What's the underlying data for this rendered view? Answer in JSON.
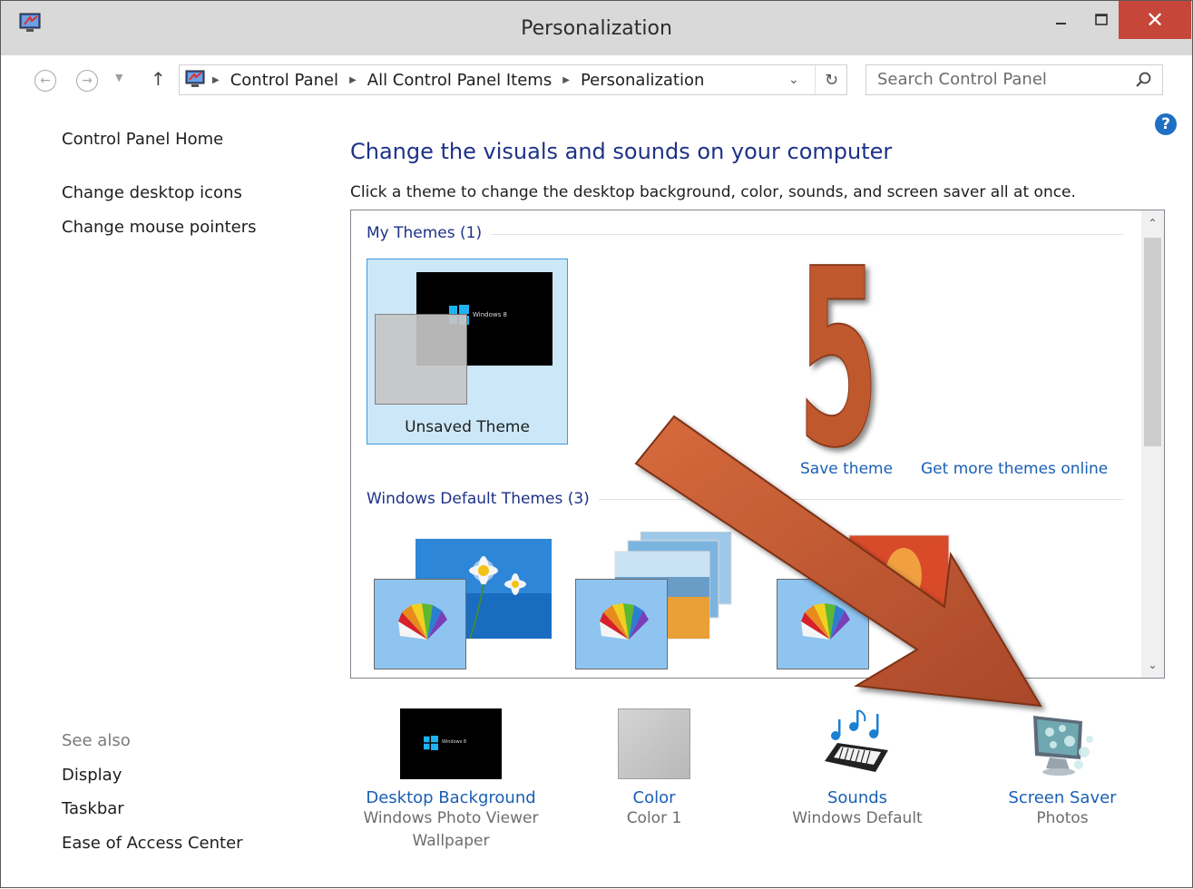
{
  "window": {
    "title": "Personalization",
    "close_glyph": "✕"
  },
  "address": {
    "crumbs": [
      "Control Panel",
      "All Control Panel Items",
      "Personalization"
    ]
  },
  "search": {
    "placeholder": "Search Control Panel"
  },
  "left_nav": {
    "items": [
      "Control Panel Home",
      "Change desktop icons",
      "Change mouse pointers"
    ]
  },
  "see_also": {
    "label": "See also",
    "items": [
      "Display",
      "Taskbar",
      "Ease of Access Center"
    ]
  },
  "main": {
    "heading": "Change the visuals and sounds on your computer",
    "subtext": "Click a theme to change the desktop background, color, sounds, and screen saver all at once.",
    "my_themes_label": "My Themes (1)",
    "selected_theme": {
      "name": "Unsaved Theme",
      "thumb_text": "Windows 8"
    },
    "save_theme": "Save theme",
    "get_more": "Get more themes online",
    "default_themes_label": "Windows Default Themes (3)"
  },
  "bottom_items": [
    {
      "title": "Desktop Background",
      "sub": "Windows Photo Viewer",
      "sub2": "Wallpaper",
      "thumb_text": "Windows 8"
    },
    {
      "title": "Color",
      "sub": "Color 1"
    },
    {
      "title": "Sounds",
      "sub": "Windows Default"
    },
    {
      "title": "Screen Saver",
      "sub": "Photos"
    }
  ],
  "annotation": {
    "step_number": "5"
  },
  "colors": {
    "accent_link": "#1a5fb4",
    "heading": "#1e3287",
    "close_button": "#c7463a",
    "annotation": "#c0582f"
  },
  "icons": [
    "control-panel-icon",
    "back-icon",
    "forward-icon",
    "up-icon",
    "refresh-icon",
    "search-icon",
    "help-icon"
  ]
}
